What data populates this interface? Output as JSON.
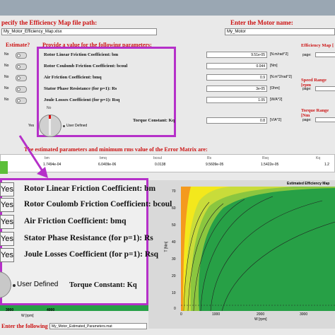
{
  "top_bar": {
    "color": "#9aa7b3"
  },
  "efficiency_path": {
    "label": "pecify the Efficiency Map file path:",
    "value": "My_Motor_Efficiency_Map.xlsx"
  },
  "motor_name": {
    "label": "Enter the Motor name:",
    "value": "My_Motor"
  },
  "params_header": {
    "estimate_label": "Estimate?",
    "provide_label": "Provide a value for the following parameters:"
  },
  "parameters": [
    {
      "toggle": "No",
      "name": "Rotor Linear Friction Coefficient: bm",
      "value": "9.51e-05",
      "unit": "[N.m/rad^2]"
    },
    {
      "toggle": "No",
      "name": "Rotor Coulomb Friction Coefficient: bcoul",
      "value": "0.044",
      "unit": "[Nm]"
    },
    {
      "toggle": "No",
      "name": "Air Friction Coefficient: bmq",
      "value": "0.9",
      "unit": "[N.m^2/rad^2]"
    },
    {
      "toggle": "No",
      "name": "Stator Phase Resistance (for p=1): Rs",
      "value": "3e-05",
      "unit": "[Ohm]"
    },
    {
      "toggle": "No",
      "name": "Joule Losses Coefficient (for p=1): Rsq",
      "value": "1.05",
      "unit": "[W/A^2]"
    }
  ],
  "torque_constant": {
    "label": "Torque Constant: Kq",
    "value": "0.8",
    "unit": "[V/A^2]"
  },
  "knob": {
    "left": "Yes",
    "right": "User Defined",
    "top": "No"
  },
  "side_labels": {
    "efficiency_map": "Efficiency Map [",
    "page1": "page:",
    "speed_range": "Speed Range [rpm",
    "page2": "page:",
    "torque_range": "Torque Range [Nm",
    "page3": "page:"
  },
  "results_header": "The estimated parameters and minimum rms value of the Error Matrix are:",
  "results_columns": [
    "bm",
    "bmq",
    "bcoul",
    "Rs",
    "Rsq",
    "Kq"
  ],
  "results_values": [
    "1.7494e-04",
    "6.0409e-06",
    "0.0138",
    "9.5609e-05",
    "1.5422e-05",
    "1.2"
  ],
  "zoom_panel": {
    "rows": [
      {
        "yes": "Yes",
        "label": "Rotor Linear Friction Coefficient: bm"
      },
      {
        "yes": "Yes",
        "label": "Rotor Coulomb Friction Coefficient: bcoul"
      },
      {
        "yes": "Yes",
        "label": "Air Friction Coefficient: bmq"
      },
      {
        "yes": "Yes",
        "label": "Stator Phase Resistance (for p=1): Rs"
      },
      {
        "yes": "Yes",
        "label": "Joule Losses Coefficient (for p=1): Rsq"
      }
    ],
    "user_defined": "User Defined",
    "torque_label": "Torque Constant: Kq"
  },
  "left_plot": {
    "ticks": [
      "3000",
      "4000"
    ],
    "xlabel": "W [rpm]"
  },
  "right_plot": {
    "title": "Estimated Efficiency Map",
    "ylabel": "T [Nm]",
    "xlabel": "W [rpm]",
    "xticks": [
      "0",
      "1000",
      "2000",
      "3000"
    ],
    "yticks": [
      "0",
      "10",
      "20",
      "30",
      "40",
      "50",
      "60",
      "70"
    ],
    "colors": {
      "high": "#27a046",
      "mid": "#8bc63f",
      "low": "#f3e81c",
      "edge": "#f49a1e"
    }
  },
  "footer": {
    "label": "Enter the following file:",
    "value": "My_Motor_Estimated_Parameters.mat"
  }
}
